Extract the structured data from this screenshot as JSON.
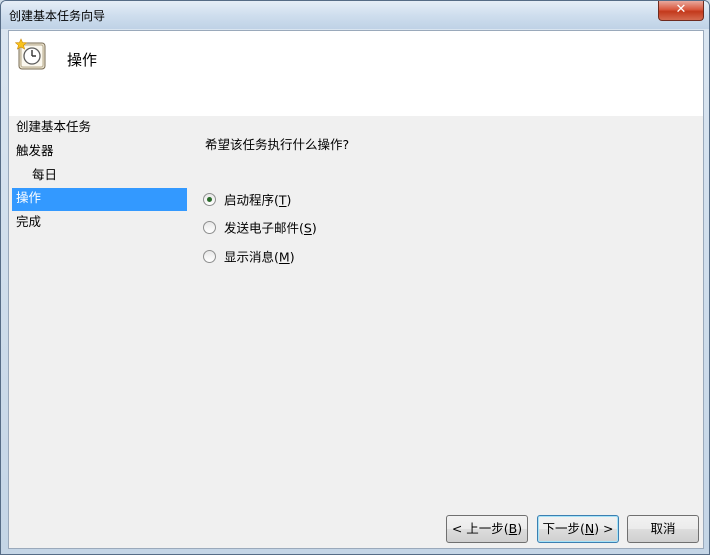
{
  "window": {
    "title": "创建基本任务向导",
    "close_label": "✕"
  },
  "header": {
    "title": "操作",
    "icon": "clock-icon"
  },
  "nav": {
    "items": [
      {
        "label": "创建基本任务"
      },
      {
        "label": "触发器"
      },
      {
        "label": "每日"
      },
      {
        "label": "操作"
      },
      {
        "label": "完成"
      }
    ],
    "selected": "操作"
  },
  "main": {
    "question": "希望该任务执行什么操作?",
    "options": [
      {
        "label_pre": "启动程序(",
        "mnemonic": "T",
        "label_post": ")",
        "checked": true
      },
      {
        "label_pre": "发送电子邮件(",
        "mnemonic": "S",
        "label_post": ")",
        "checked": false
      },
      {
        "label_pre": "显示消息(",
        "mnemonic": "M",
        "label_post": ")",
        "checked": false
      }
    ]
  },
  "buttons": {
    "back": {
      "pre": "< 上一步(",
      "mnemonic": "B",
      "post": ")"
    },
    "next": {
      "pre": "下一步(",
      "mnemonic": "N",
      "post": ") >"
    },
    "cancel": {
      "label": "取消"
    }
  },
  "colors": {
    "selection": "#3399ff",
    "close": "#c3391c",
    "header_bg": "#ffffff",
    "body_bg": "#f0f0f0"
  }
}
